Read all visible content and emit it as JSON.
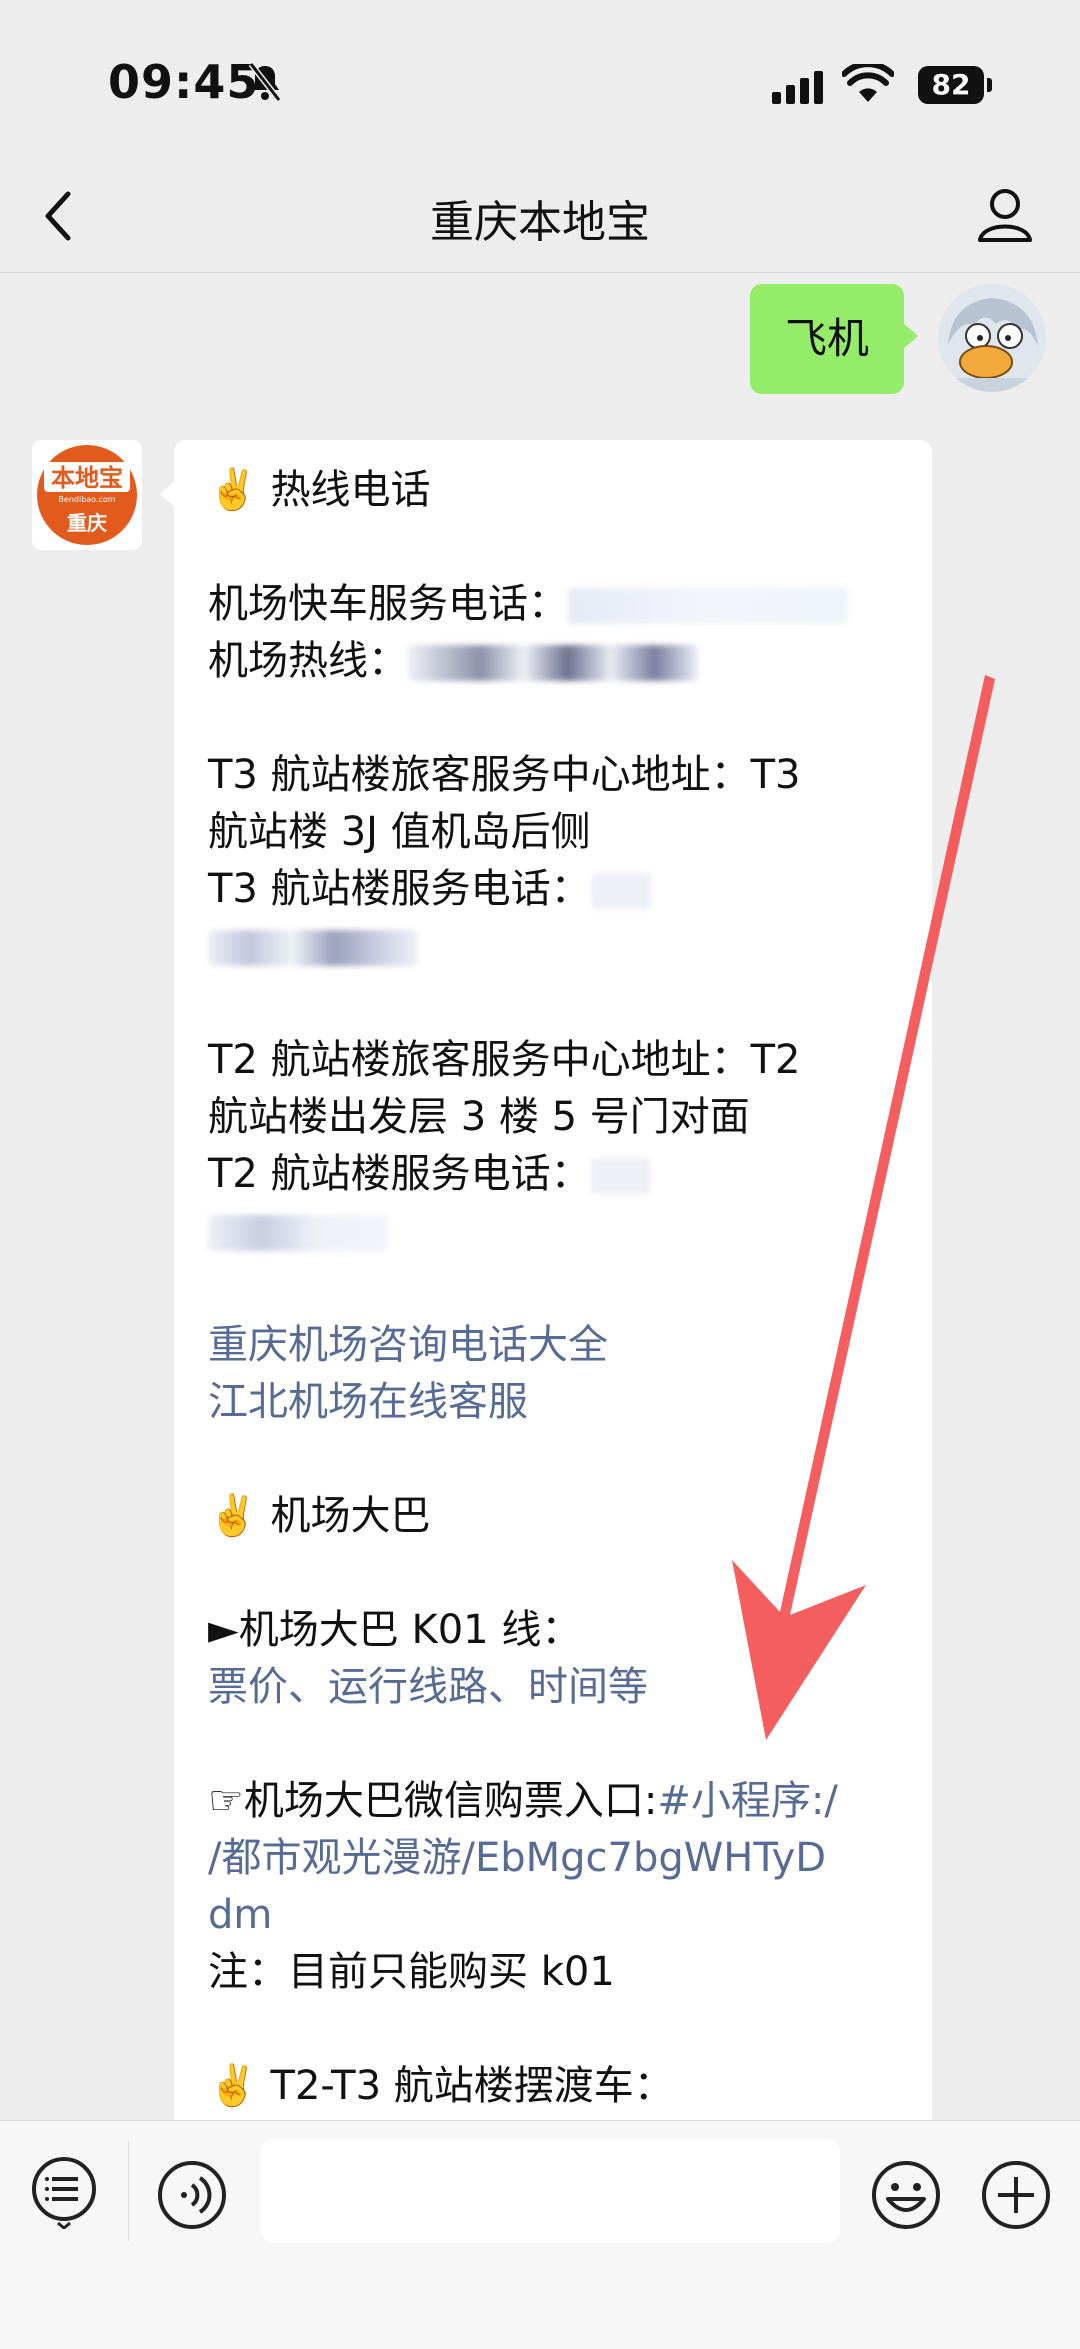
{
  "status_bar": {
    "time": "09:45",
    "battery": "82"
  },
  "nav": {
    "title": "重庆本地宝"
  },
  "outgoing": {
    "text": "飞机"
  },
  "bot_avatar": {
    "top_text": "本地宝",
    "small_text": "Bendibao.com",
    "bottom_text": "重庆"
  },
  "message": {
    "h1": "✌️ 热线电话",
    "l1": "机场快车服务电话：",
    "l2": "机场热线：",
    "l3": "T3 航站楼旅客服务中心地址：T3",
    "l4": "航站楼 3J 值机岛后侧",
    "l5": "T3 航站楼服务电话：",
    "l6": "T2 航站楼旅客服务中心地址：T2",
    "l7": "航站楼出发层 3 楼 5 号门对面",
    "l8": "T2 航站楼服务电话：",
    "link1": "重庆机场咨询电话大全",
    "link2": "江北机场在线客服",
    "h2": "✌️ 机场大巴",
    "l9": "►机场大巴 K01 线：",
    "link3": "票价、运行线路、时间等",
    "l10": "☞机场大巴微信购票入口:",
    "link4a": "#小程序:/",
    "link4b": "/都市观光漫游/EbMgc7bgWHTyD",
    "link4c": "dm",
    "l11": "注：目前只能购买 k01",
    "h3": "✌️ T2-T3 航站楼摆渡车："
  },
  "input": {
    "placeholder": ""
  },
  "colors": {
    "accent_green": "#95ec69",
    "link": "#576b95",
    "arrow": "#f35050"
  }
}
